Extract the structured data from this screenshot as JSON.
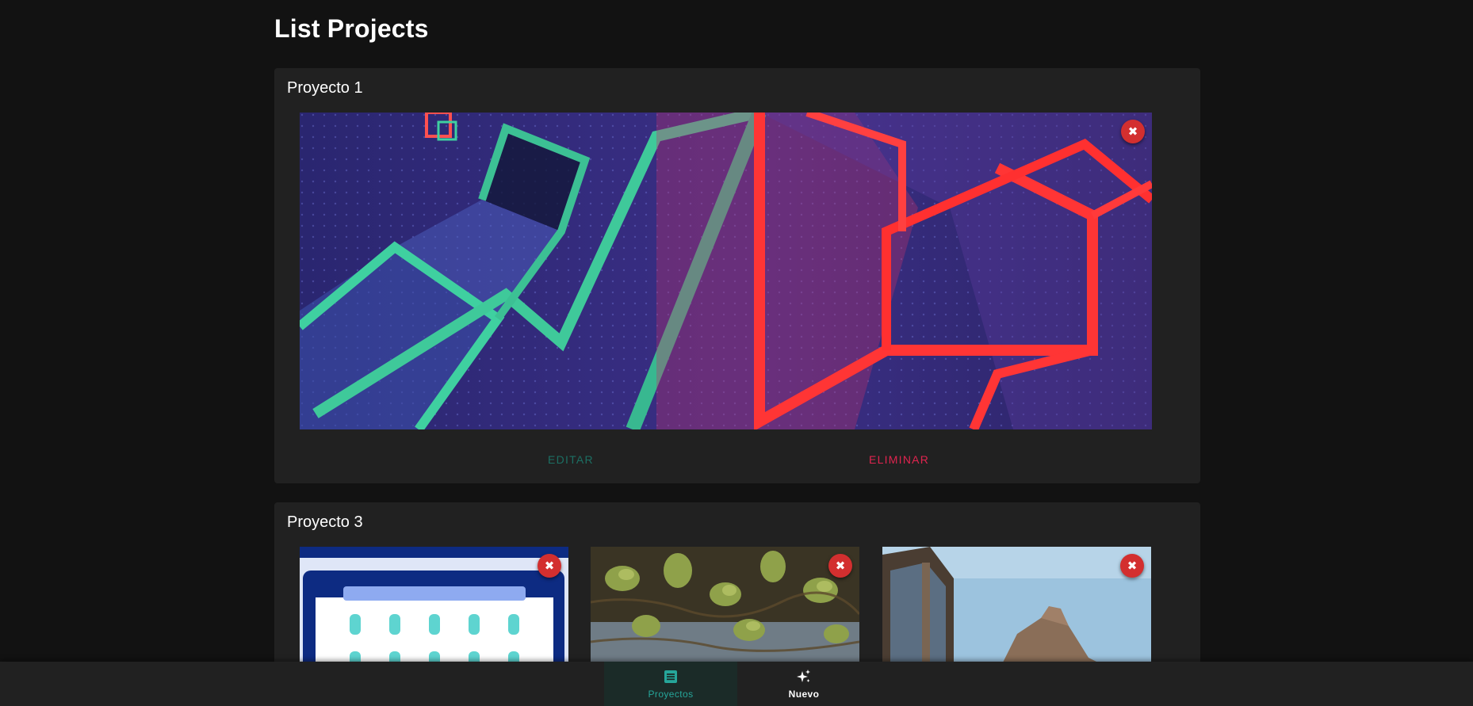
{
  "page": {
    "title": "List Projects"
  },
  "projects": [
    {
      "title": "Proyecto 1",
      "remove_glyph": "✖"
    },
    {
      "title": "Proyecto 3",
      "remove_glyph": "✖"
    }
  ],
  "actions": {
    "edit_label": "EDITAR",
    "delete_label": "ELIMINAR"
  },
  "bottom_nav": {
    "items": [
      {
        "label": "Proyectos",
        "icon": "list-icon",
        "active": true
      },
      {
        "label": "Nuevo",
        "icon": "sparkles-icon",
        "active": false
      }
    ]
  },
  "colors": {
    "background": "#121212",
    "card": "#212121",
    "accent_teal": "#26a69a",
    "danger": "#d32f2f",
    "delete_text": "#e0244f"
  }
}
